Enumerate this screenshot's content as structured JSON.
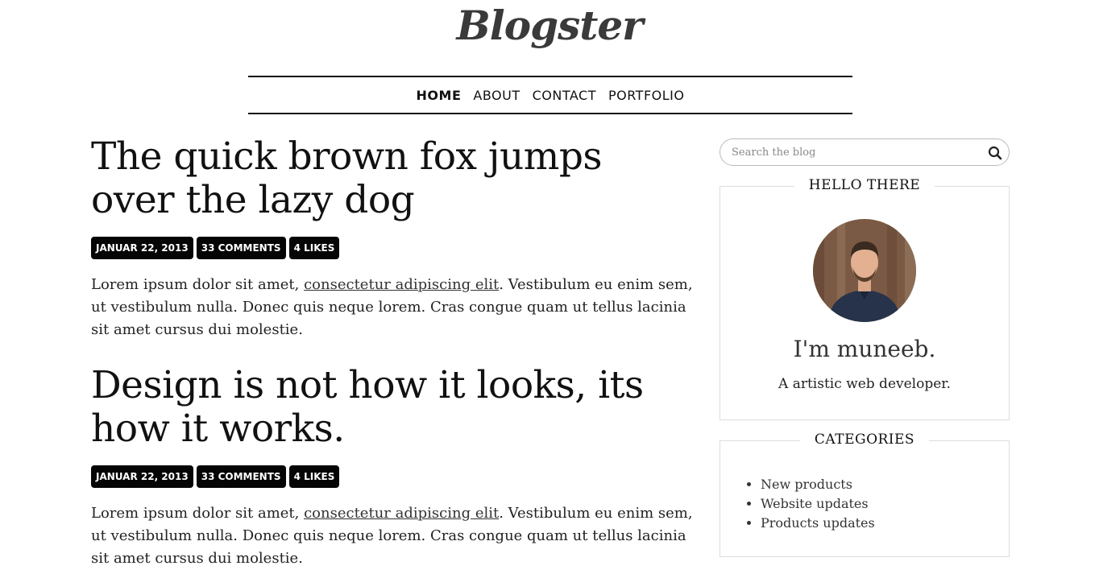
{
  "site": {
    "logo": "Blogster"
  },
  "nav": {
    "items": [
      {
        "label": "HOME",
        "active": true
      },
      {
        "label": "ABOUT"
      },
      {
        "label": "CONTACT"
      },
      {
        "label": "PORTFOLIO"
      }
    ]
  },
  "posts": [
    {
      "title": "The quick brown fox jumps over the lazy dog",
      "date": "JANUAR 22, 2013",
      "comments": "33 COMMENTS",
      "likes": "4 LIKES",
      "excerpt_before": "Lorem ipsum dolor sit amet, ",
      "excerpt_link": "consectetur adipiscing elit",
      "excerpt_after": ". Vestibulum eu enim sem, ut vestibulum nulla. Donec quis neque lorem. Cras congue quam ut tellus lacinia sit amet cursus dui molestie."
    },
    {
      "title": "Design is not how it looks, its how it works.",
      "date": "JANUAR 22, 2013",
      "comments": "33 COMMENTS",
      "likes": "4 LIKES",
      "excerpt_before": "Lorem ipsum dolor sit amet, ",
      "excerpt_link": "consectetur adipiscing elit",
      "excerpt_after": ". Vestibulum eu enim sem, ut vestibulum nulla. Donec quis neque lorem. Cras congue quam ut tellus lacinia sit amet cursus dui molestie."
    }
  ],
  "sidebar": {
    "search": {
      "placeholder": "Search the blog",
      "icon": "search-icon"
    },
    "about": {
      "title": "HELLO THERE",
      "name": "I'm muneeb.",
      "desc": "A artistic web developer."
    },
    "categories": {
      "title": "CATEGORIES",
      "items": [
        "New products",
        "Website updates",
        "Products updates"
      ]
    }
  },
  "colors": {
    "badge_bg": "#050505",
    "text": "#111111",
    "border": "#dddddd"
  }
}
